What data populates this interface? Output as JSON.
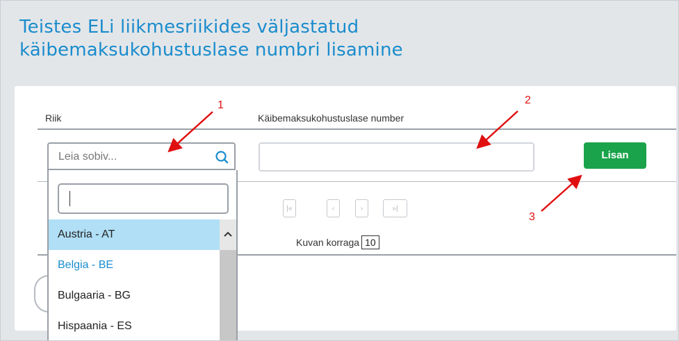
{
  "title": {
    "line1": "Teistes ELi liikmesriikides väljastatud",
    "line2": "käibemaksukohustuslase numbri lisamine"
  },
  "form": {
    "country_header": "Riik",
    "vat_header": "Käibemaksukohustuslase number",
    "country_placeholder": "Leia sobiv...",
    "vat_value": "",
    "add_button": "Lisan"
  },
  "dropdown": {
    "filter_value": "",
    "items": [
      {
        "label": "Austria - AT",
        "state": "highlighted"
      },
      {
        "label": "Belgia - BE",
        "state": "selected"
      },
      {
        "label": "Bulgaaria - BG",
        "state": "normal"
      },
      {
        "label": "Hispaania - ES",
        "state": "normal"
      }
    ]
  },
  "pager": {
    "first": "|«",
    "prev": "‹",
    "next": "›",
    "last": "»|",
    "per_page_label": "Kuvan korraga",
    "per_page_value": "10"
  },
  "annotations": [
    "1",
    "2",
    "3"
  ],
  "colors": {
    "title": "#1a8ccc",
    "add_button": "#1aa34a",
    "highlight": "#b0dff6",
    "selected_text": "#1a8ccc",
    "annotation": "#e01010"
  },
  "icons": {
    "search": "search-icon",
    "scroll_up": "chevron-up-icon"
  }
}
